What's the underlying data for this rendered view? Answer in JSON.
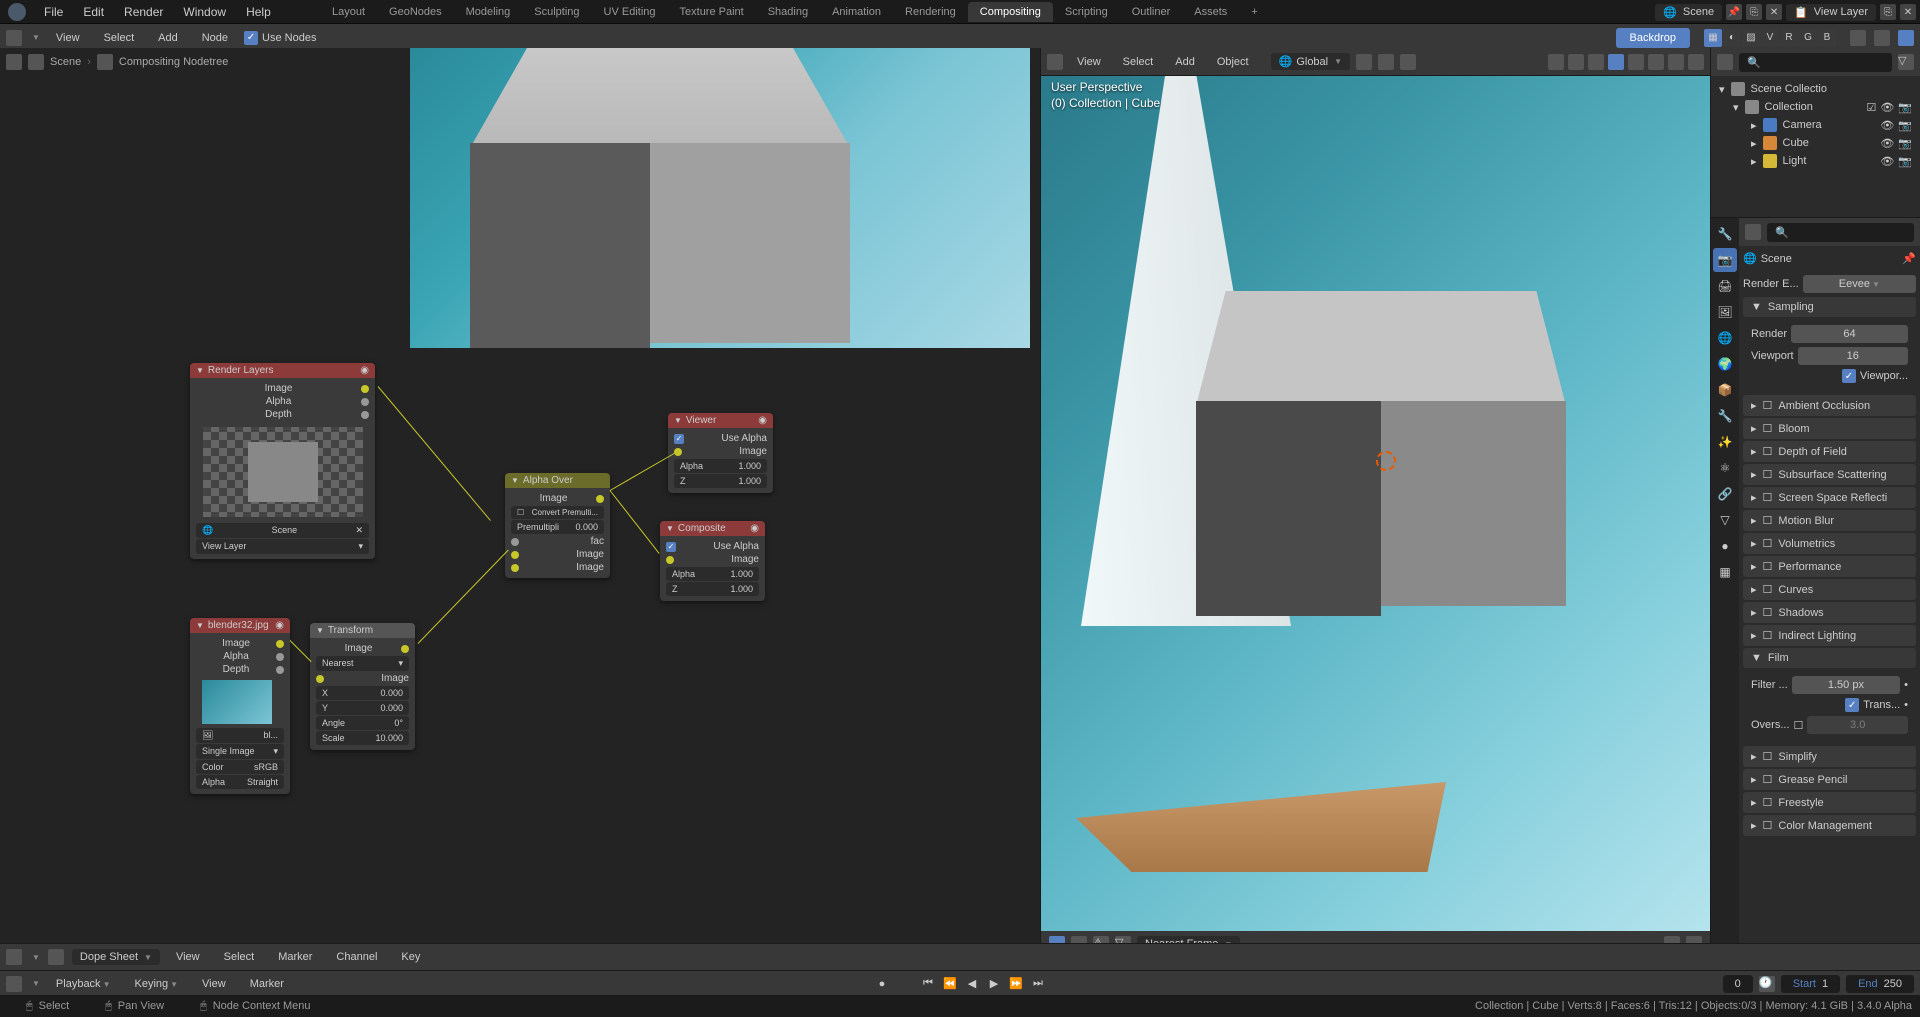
{
  "menu": {
    "file": "File",
    "edit": "Edit",
    "render": "Render",
    "window": "Window",
    "help": "Help"
  },
  "workspaces": [
    "Layout",
    "GeoNodes",
    "Modeling",
    "Sculpting",
    "UV Editing",
    "Texture Paint",
    "Shading",
    "Animation",
    "Rendering",
    "Compositing",
    "Scripting",
    "Outliner",
    "Assets"
  ],
  "workspace_active": "Compositing",
  "scene": {
    "name": "Scene",
    "layer": "View Layer"
  },
  "compositor_hdr": {
    "view": "View",
    "select": "Select",
    "add": "Add",
    "node": "Node",
    "use_nodes": "Use Nodes",
    "backdrop": "Backdrop",
    "channels": [
      "V",
      "R",
      "G",
      "B"
    ]
  },
  "breadcrumb": {
    "scene": "Scene",
    "tree": "Compositing Nodetree"
  },
  "nodes": {
    "render_layers": {
      "title": "Render Layers",
      "outs": [
        "Image",
        "Alpha",
        "Depth"
      ],
      "scene": "Scene",
      "view_layer": "View Layer"
    },
    "image": {
      "title": "blender32.jpg",
      "outs": [
        "Image",
        "Alpha",
        "Depth"
      ],
      "source": "Single Image",
      "color": "Color",
      "color_v": "sRGB",
      "alpha": "Alpha",
      "alpha_v": "Straight",
      "filename": "bl..."
    },
    "transform": {
      "title": "Transform",
      "out": "Image",
      "interp": "Nearest",
      "in": "Image",
      "x": "X",
      "x_v": "0.000",
      "y": "Y",
      "y_v": "0.000",
      "angle": "Angle",
      "angle_v": "0°",
      "scale": "Scale",
      "scale_v": "10.000"
    },
    "alpha_over": {
      "title": "Alpha Over",
      "out": "Image",
      "convert": "Convert Premulti...",
      "premul": "Premultipli",
      "premul_v": "0.000",
      "fac": "fac",
      "img1": "Image",
      "img2": "Image"
    },
    "viewer": {
      "title": "Viewer",
      "use_alpha": "Use Alpha",
      "image": "Image",
      "alpha": "Alpha",
      "alpha_v": "1.000",
      "z": "Z",
      "z_v": "1.000"
    },
    "composite": {
      "title": "Composite",
      "use_alpha": "Use Alpha",
      "image": "Image",
      "alpha": "Alpha",
      "alpha_v": "1.000",
      "z": "Z",
      "z_v": "1.000"
    }
  },
  "viewport": {
    "hdr": {
      "view": "View",
      "select": "Select",
      "add": "Add",
      "object": "Object",
      "orientation": "Global"
    },
    "overlay1": "User Perspective",
    "overlay2": "(0) Collection | Cube",
    "snap": "Nearest Frame"
  },
  "outliner": {
    "root": "Scene Collectio",
    "collection": "Collection",
    "items": [
      {
        "name": "Camera",
        "type": "cam"
      },
      {
        "name": "Cube",
        "type": "mesh"
      },
      {
        "name": "Light",
        "type": "light"
      }
    ]
  },
  "properties": {
    "scene": "Scene",
    "engine_label": "Render E...",
    "engine": "Eevee",
    "sampling": {
      "title": "Sampling",
      "render": "Render",
      "render_v": "64",
      "viewport": "Viewport",
      "viewport_v": "16",
      "viewport_denoise": "Viewpor..."
    },
    "panels": [
      "Ambient Occlusion",
      "Bloom",
      "Depth of Field",
      "Subsurface Scattering",
      "Screen Space Reflecti",
      "Motion Blur",
      "Volumetrics",
      "Performance",
      "Curves",
      "Shadows",
      "Indirect Lighting"
    ],
    "film": {
      "title": "Film",
      "filter": "Filter ...",
      "filter_v": "1.50 px",
      "trans": "Trans...",
      "overs": "Overs...",
      "overs_v": "3.0"
    },
    "end_panels": [
      "Simplify",
      "Grease Pencil",
      "Freestyle",
      "Color Management"
    ]
  },
  "dope": {
    "label": "Dope Sheet",
    "menus": [
      "View",
      "Select",
      "Marker",
      "Channel",
      "Key"
    ]
  },
  "timeline": {
    "playback": "Playback",
    "keying": "Keying",
    "view": "View",
    "marker": "Marker",
    "frame": "0",
    "start": "Start",
    "start_v": "1",
    "end": "End",
    "end_v": "250"
  },
  "status": {
    "select": "Select",
    "pan": "Pan View",
    "context": "Node Context Menu",
    "right": "Collection | Cube | Verts:8 | Faces:6 | Tris:12 | Objects:0/3 | Memory: 4.1 GiB | 3.4.0 Alpha"
  }
}
